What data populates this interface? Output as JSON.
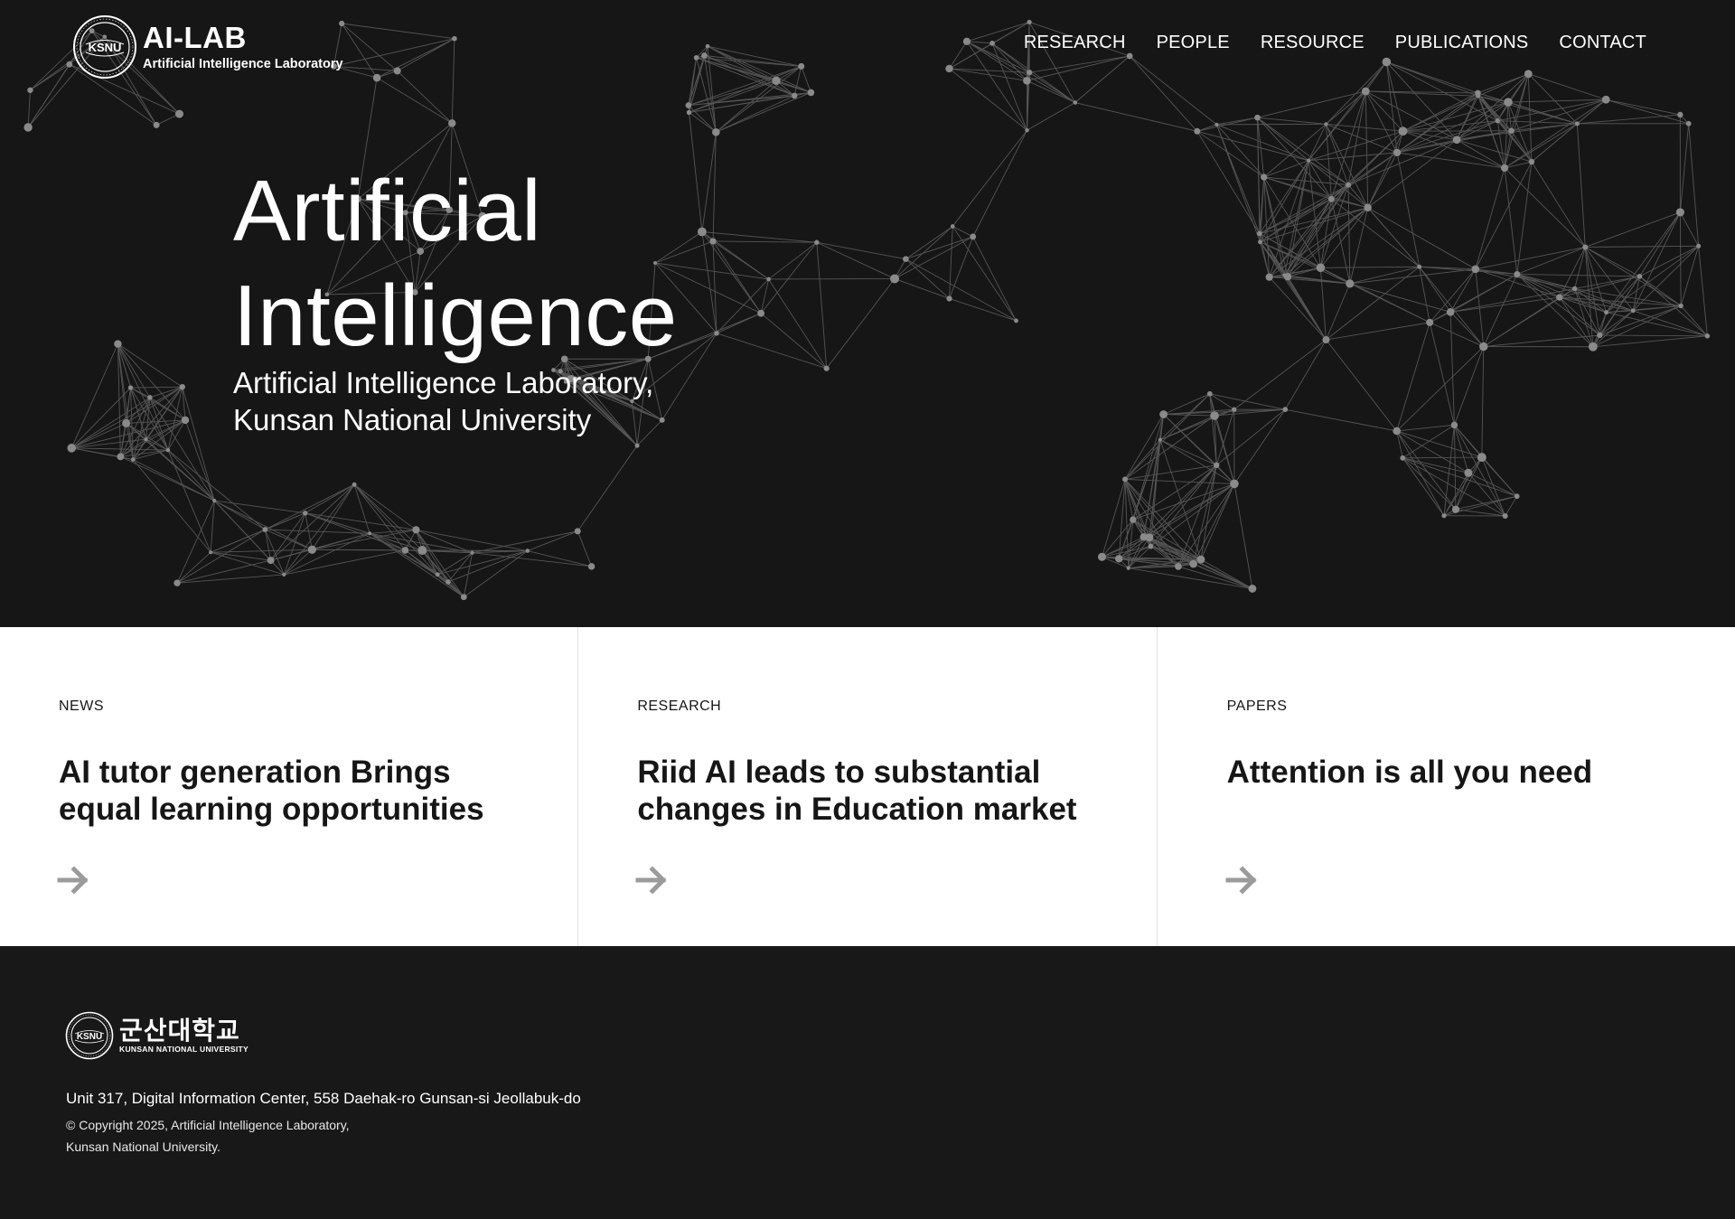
{
  "brand": {
    "title": "AI-LAB",
    "subtitle": "Artificial Intelligence Laboratory",
    "seal_text": "KSNU"
  },
  "nav": [
    "RESEARCH",
    "PEOPLE",
    "RESOURCE",
    "PUBLICATIONS",
    "CONTACT"
  ],
  "hero": {
    "title_line1": "Artificial",
    "title_line2": "Intelligence",
    "sub_line1": "Artificial Intelligence Laboratory,",
    "sub_line2": "Kunsan National University"
  },
  "cards": [
    {
      "category": "NEWS",
      "title_line1": "AI tutor generation Brings",
      "title_line2": "equal learning opportunities",
      "arrow_icon": "arrow-right-icon"
    },
    {
      "category": "RESEARCH",
      "title_line1": "Riid AI leads to substantial",
      "title_line2": "changes in Education market",
      "arrow_icon": "arrow-right-icon"
    },
    {
      "category": "PAPERS",
      "title_line1": "Attention is all you need",
      "title_line2": "",
      "arrow_icon": "arrow-right-icon"
    }
  ],
  "footer": {
    "university_kr": "군산대학교",
    "university_en": "KUNSAN NATIONAL UNIVERSITY",
    "address": "Unit 317, Digital Information Center, 558 Daehak-ro Gunsan-si Jeollabuk-do",
    "copyright_line1": "© Copyright 2025, Artificial Intelligence Laboratory,",
    "copyright_line2": "Kunsan National University."
  },
  "colors": {
    "hero_bg": "#161616",
    "footer_bg": "#181818",
    "card_bg": "#ffffff",
    "arrow": "#9b9b9b",
    "network": "#6a6a6a"
  }
}
